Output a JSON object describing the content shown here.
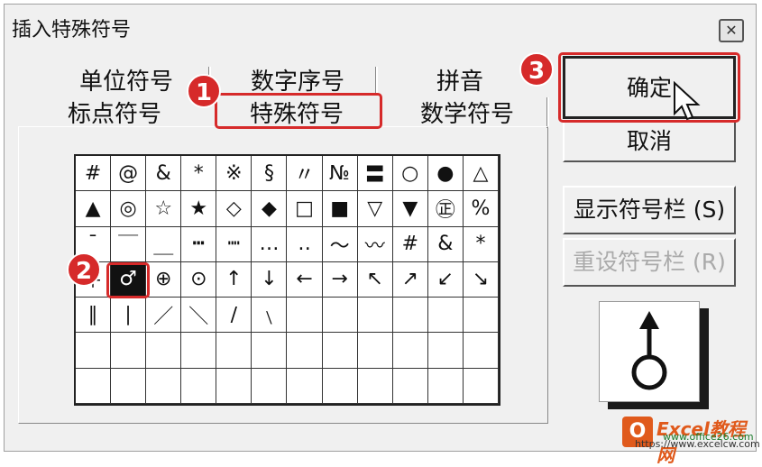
{
  "dialog": {
    "title": "插入特殊符号",
    "close_label": "✕"
  },
  "tabs": {
    "back_row": [
      "单位符号",
      "数字序号",
      "拼音"
    ],
    "front_row": [
      "标点符号",
      "特殊符号",
      "数学符号"
    ],
    "active": "特殊符号"
  },
  "symbols": [
    "#",
    "@",
    "&",
    "*",
    "※",
    "§",
    "〃",
    "№",
    "〓",
    "○",
    "●",
    "△",
    "▲",
    "◎",
    "☆",
    "★",
    "◇",
    "◆",
    "□",
    "■",
    "▽",
    "▼",
    "㊣",
    "%",
    "¯",
    "￣",
    "＿",
    "┅",
    "┉",
    "…",
    "‥",
    "～",
    "〰",
    "#",
    "&",
    "*",
    "＋",
    "♂",
    "⊕",
    "⊙",
    "↑",
    "↓",
    "←",
    "→",
    "↖",
    "↗",
    "↙",
    "↘",
    "∥",
    "∣",
    "／",
    "＼",
    "∕",
    "﹨",
    "",
    "",
    "",
    "",
    "",
    "",
    "",
    "",
    "",
    "",
    "",
    "",
    "",
    "",
    "",
    "",
    "",
    "",
    "",
    "",
    "",
    "",
    "",
    "",
    "",
    "",
    "",
    "",
    "",
    ""
  ],
  "selected_index": 37,
  "preview_symbol": "♂",
  "buttons": {
    "ok": "确定",
    "cancel": "取消",
    "show_bar": "显示符号栏 (S)",
    "reset_bar": "重设符号栏 (R)"
  },
  "badges": [
    "1",
    "2",
    "3"
  ],
  "watermark": {
    "title": "Excel教程网",
    "url": "www.office26.com",
    "url2": "https://www.excelcw.com"
  },
  "colors": {
    "accent_red": "#d62a2a",
    "dialog_bg": "#f0f0f0"
  }
}
